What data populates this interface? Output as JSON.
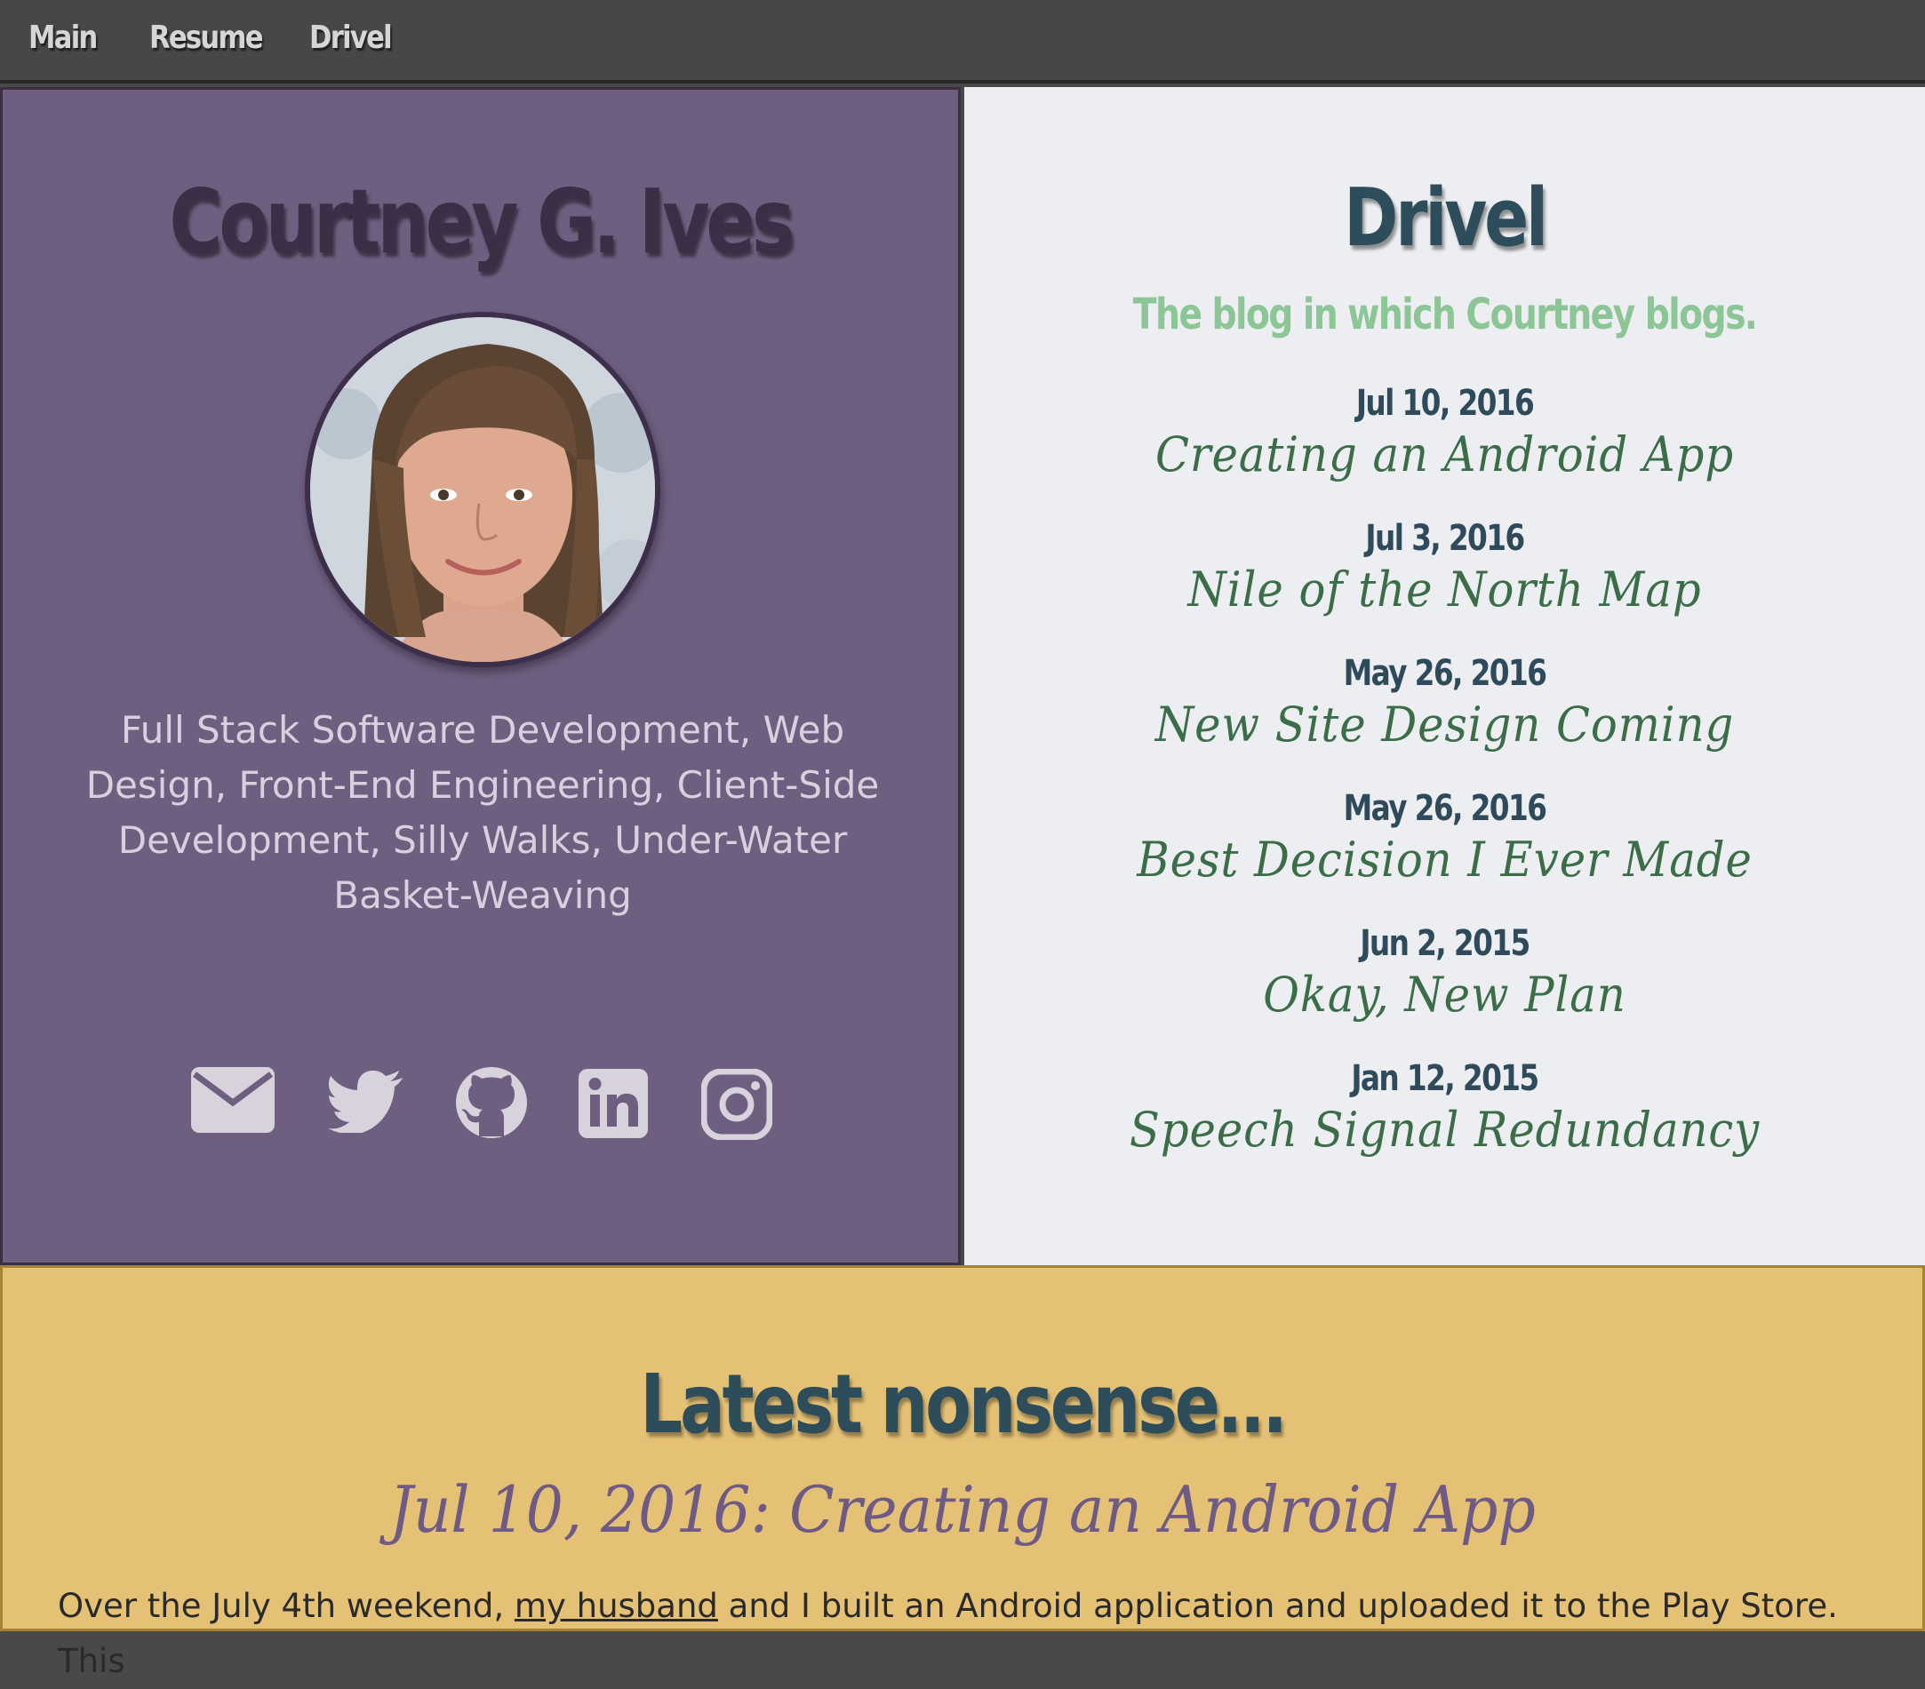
{
  "nav": {
    "main": "Main",
    "resume": "Resume",
    "drivel": "Drivel"
  },
  "profile": {
    "name": "Courtney G. Ives",
    "tagline": "Full Stack Software Development, Web Design, Front-End Engineering, Client-Side Development, Silly Walks, Under-Water Basket-Weaving",
    "socials": [
      "envelope-icon",
      "twitter-icon",
      "github-icon",
      "linkedin-icon",
      "instagram-icon"
    ]
  },
  "blog": {
    "title": "Drivel",
    "subtitle": "The blog in which Courtney blogs.",
    "posts": [
      {
        "date": "Jul 10, 2016",
        "title": "Creating an Android App"
      },
      {
        "date": "Jul 3, 2016",
        "title": "Nile of the North Map"
      },
      {
        "date": "May 26, 2016",
        "title": "New Site Design Coming"
      },
      {
        "date": "May 26, 2016",
        "title": "Best Decision I Ever Made"
      },
      {
        "date": "Jun 2, 2015",
        "title": "Okay, New Plan"
      },
      {
        "date": "Jan 12, 2015",
        "title": "Speech Signal Redundancy"
      }
    ]
  },
  "latest": {
    "heading": "Latest nonsense...",
    "post_title": "Jul 10, 2016: Creating an Android App",
    "body_before": "Over the July 4th weekend, ",
    "body_link": "my husband",
    "body_after": " and I built an Android application and uploaded it to the Play Store. This"
  },
  "colors": {
    "nav_bg": "#474747",
    "profile_bg": "#6e5f80",
    "blog_bg": "#eceef1",
    "latest_bg": "#e5c175",
    "accent_green": "#8cc596",
    "heading_blue": "#2e4d5b"
  }
}
